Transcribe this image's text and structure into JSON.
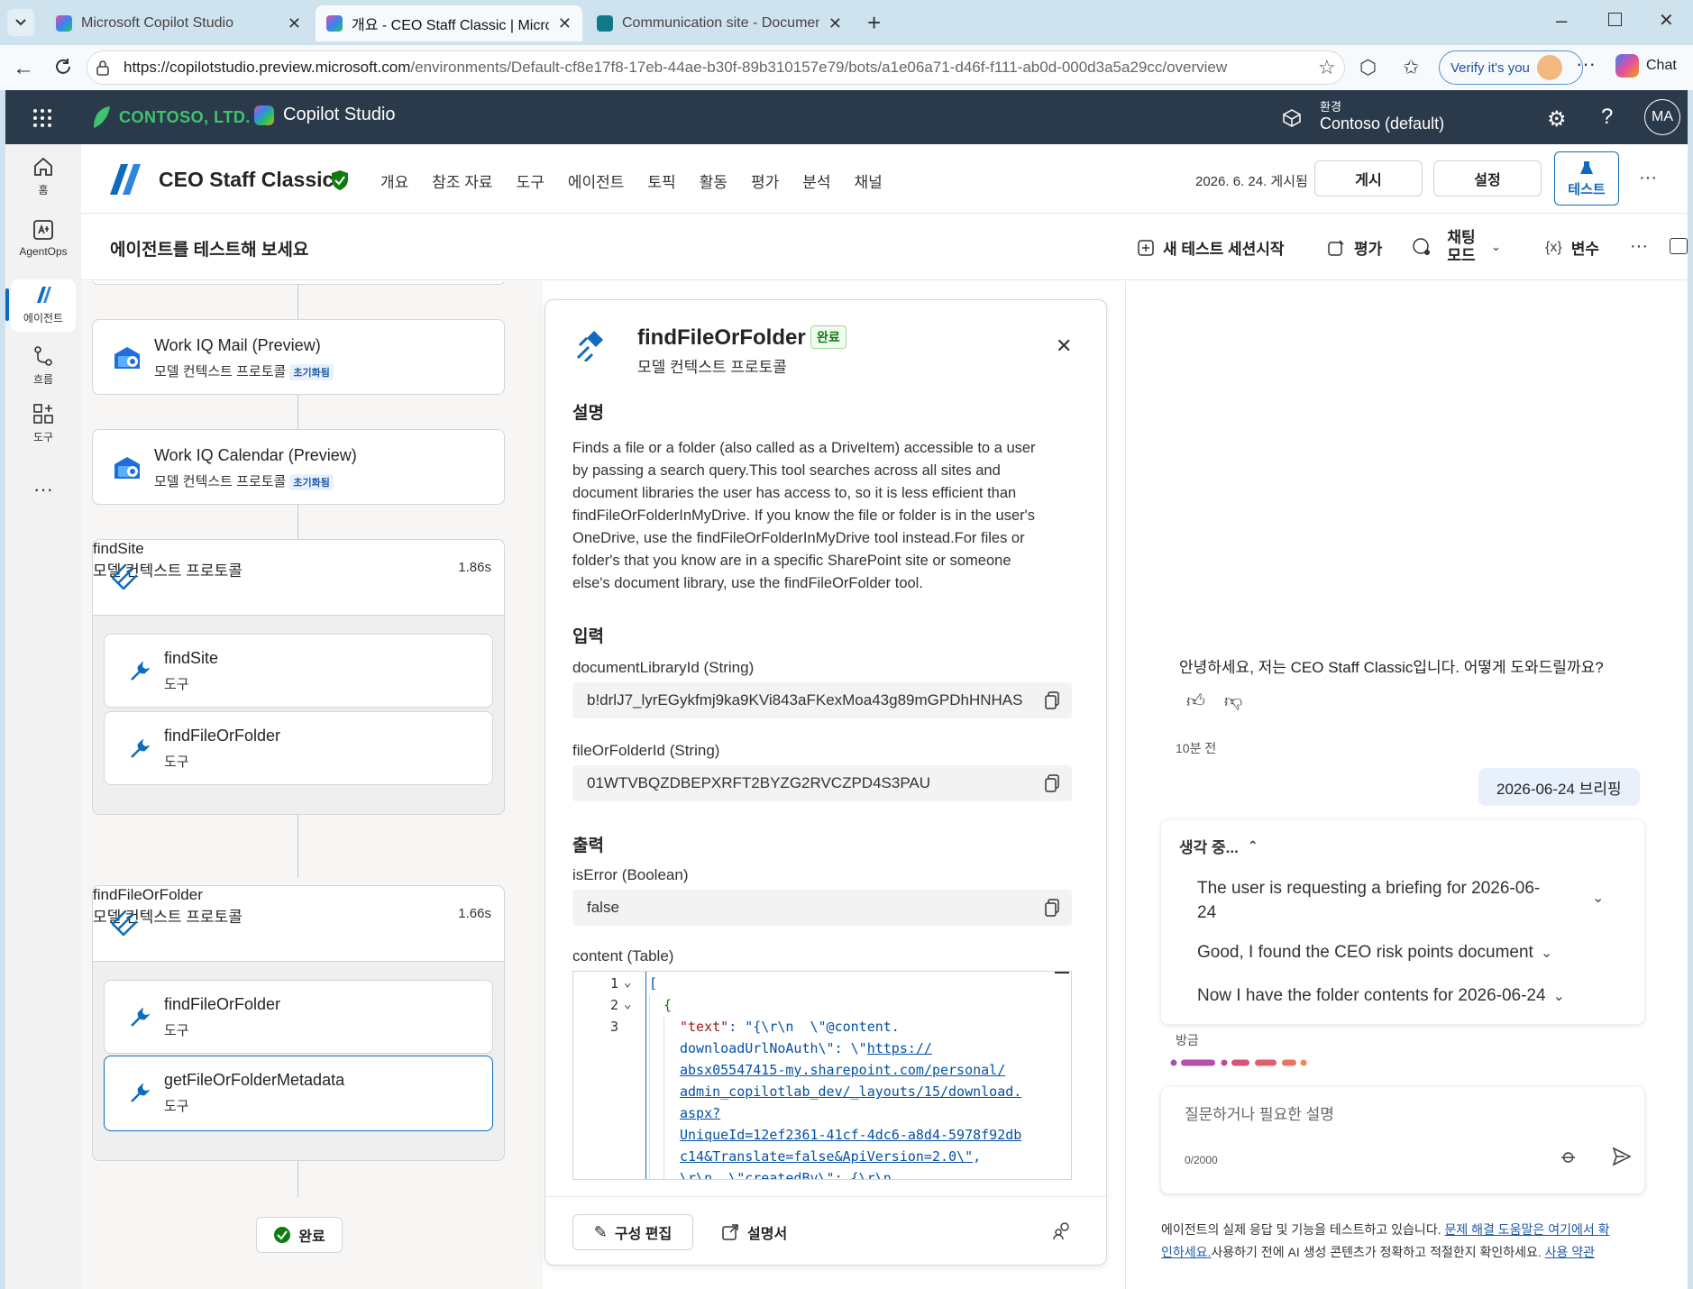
{
  "browser": {
    "tabs": [
      {
        "title": "Microsoft Copilot Studio",
        "active": false
      },
      {
        "title": "개요 - CEO Staff Classic | Microsoft",
        "active": true
      },
      {
        "title": "Communication site - Documents",
        "active": false
      }
    ],
    "url_host": "https://copilotstudio.preview.microsoft.com",
    "url_path": "/environments/Default-cf8e17f8-17eb-44ae-b30f-89b310157e79/bots/a1e06a71-d46f-f111-ab0d-000d3a5a29cc/overview",
    "verify_label": "Verify it's you",
    "chat_label": "Chat"
  },
  "app": {
    "org_name": "CONTOSO, LTD.",
    "product_name": "Copilot Studio",
    "env_label": "환경",
    "env_value": "Contoso (default)",
    "user_initials": "MA"
  },
  "rail": {
    "items": [
      {
        "label": "홈",
        "icon": "home-icon"
      },
      {
        "label": "AgentOps",
        "icon": "agentops-icon"
      },
      {
        "label": "에이전트",
        "icon": "agent-icon",
        "active": true
      },
      {
        "label": "흐름",
        "icon": "flow-icon"
      },
      {
        "label": "도구",
        "icon": "tools-icon"
      }
    ],
    "more": "···"
  },
  "agent": {
    "name": "CEO Staff Classic",
    "tabs": [
      "개요",
      "참조 자료",
      "도구",
      "에이전트",
      "토픽",
      "활동",
      "평가",
      "분석",
      "채널"
    ],
    "published": "2026. 6. 24. 게시됨",
    "publish_btn": "게시",
    "settings_btn": "설정",
    "test_btn": "테스트"
  },
  "test_bar": {
    "title": "에이전트를 테스트해 보세요",
    "new_session": "새 테스트 세션시작",
    "evaluate": "평가",
    "chat_mode": "채팅 모드",
    "variables": "변수"
  },
  "canvas": {
    "cards": [
      {
        "name": "Work IQ Mail (Preview)",
        "sub": "모델 컨텍스트 프로토콜",
        "badge": "초기화됨"
      },
      {
        "name": "Work IQ Calendar (Preview)",
        "sub": "모델 컨텍스트 프로토콜",
        "badge": "초기화됨"
      }
    ],
    "groups": [
      {
        "name": "findSite",
        "sub": "모델 컨텍스트 프로토콜",
        "time": "1.86s",
        "tools": [
          {
            "name": "findSite",
            "sub": "도구"
          },
          {
            "name": "findFileOrFolder",
            "sub": "도구"
          }
        ]
      },
      {
        "name": "findFileOrFolder",
        "sub": "모델 컨텍스트 프로토콜",
        "time": "1.66s",
        "tools": [
          {
            "name": "findFileOrFolder",
            "sub": "도구"
          },
          {
            "name": "getFileOrFolderMetadata",
            "sub": "도구"
          }
        ]
      }
    ],
    "done": "완료"
  },
  "panel": {
    "title": "findFileOrFolder",
    "status": "완료",
    "subtitle": "모델 컨텍스트 프로토콜",
    "desc_heading": "설명",
    "description": [
      "Finds a file or a folder (also called as a DriveItem) accessible to a user",
      "by passing a search query.This tool searches across all sites and",
      "document libraries the user has access to, so it is less efficient than",
      "findFileOrFolderInMyDrive. If you know the file or folder is in the user's",
      "OneDrive, use the findFileOrFolderInMyDrive tool instead.For files or",
      "folder's that you know are in a specific SharePoint site or someone",
      "else's document library, use the findFileOrFolder tool."
    ],
    "input_heading": "입력",
    "inputs": [
      {
        "label": "documentLibraryId (String)",
        "value": "b!drlJ7_lyrEGykfmj9ka9KVi843aFKexMoa43g89mGPDhHNHAS"
      },
      {
        "label": "fileOrFolderId (String)",
        "value": "01WTVBQZDBEPXRFT2BYZG2RVCZPD4S3PAU"
      }
    ],
    "output_heading": "출력",
    "outputs": [
      {
        "label": "isError (Boolean)",
        "value": "false"
      }
    ],
    "content_label": "content (Table)",
    "code_lines": {
      "l1": "[",
      "l2": "{",
      "key": "\"text\"",
      "v1": "\"{\\r\\n  \\\"@content.",
      "v2": "downloadUrlNoAuth\\\": \\\"",
      "u1": "https://",
      "u2": "absx05547415-my.sharepoint.com/personal/",
      "u3": "admin_copilotlab_dev/_layouts/15/download.",
      "u4": "aspx?",
      "u5": "UniqueId=12ef2361-41cf-4dc6-a8d4-5978f92db",
      "u6": "c14&Translate=false&ApiVersion=2.0\\\"",
      "v3": "\\r\\n  \\\"createdBy\\\": {\\r\\n"
    },
    "edit_btn": "구성 편집",
    "docs_btn": "설명서"
  },
  "chat": {
    "greeting": "안녕하세요, 저는 CEO Staff Classic입니다. 어떻게 도와드릴까요?",
    "time_ago": "10분 전",
    "user_msg": "2026-06-24 브리핑",
    "thinking_label": "생각 중...",
    "thoughts": [
      "The user is requesting a briefing for 2026-06-",
      "24",
      "Good, I found the CEO risk points document",
      "Now I have the folder contents for 2026-06-24"
    ],
    "just_now": "방금",
    "input_placeholder": "질문하거나 필요한 설명",
    "char_count": "0/2000",
    "footer_text1": "에이전트의 실제 응답 및 기능을 테스트하고 있습니다.",
    "footer_link1a": "문제 해결 도움말은 여기에서 확",
    "footer_link1b": "인하세요.",
    "footer_text2": "사용하기 전에 AI 생성 콘텐츠가 정확하고 적절한지 확인하세요.",
    "footer_link2": "사용 약관"
  },
  "colors": {
    "app_header": "#2b3a4a",
    "accent": "#0f6cbd",
    "success": "#107c10"
  }
}
